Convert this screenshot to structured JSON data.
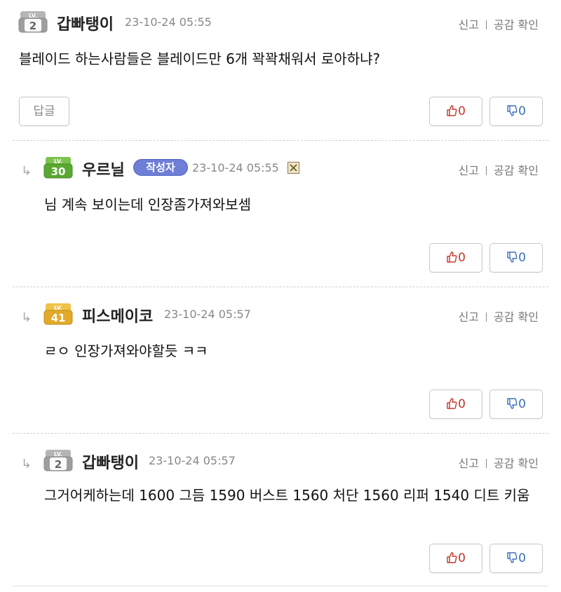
{
  "comments": [
    {
      "level": "2",
      "nickname": "갑빠탱이",
      "date": "23-10-24 05:55",
      "report": "신고",
      "likes_check": "공감 확인",
      "body": "블레이드 하는사람들은 블레이드만 6개 꽉꽉채워서 로아하냐?",
      "reply_label": "답글",
      "up_count": "0",
      "down_count": "0"
    },
    {
      "level": "30",
      "nickname": "우르닐",
      "author_badge": "작성자",
      "date": "23-10-24 05:55",
      "report": "신고",
      "likes_check": "공감 확인",
      "body": "님 계속 보이는데 인장좀가져와보셈",
      "up_count": "0",
      "down_count": "0"
    },
    {
      "level": "41",
      "nickname": "피스메이코",
      "date": "23-10-24 05:57",
      "report": "신고",
      "likes_check": "공감 확인",
      "body": "ㄹㅇ 인장가져와야할듯 ㅋㅋ",
      "up_count": "0",
      "down_count": "0"
    },
    {
      "level": "2",
      "nickname": "갑빠탱이",
      "date": "23-10-24 05:57",
      "report": "신고",
      "likes_check": "공감 확인",
      "body": "그거어케하는데 1600 그듬 1590 버스트 1560 처단 1560 리퍼 1540 디트 키움",
      "up_count": "0",
      "down_count": "0"
    }
  ],
  "colors": {
    "level_gray": "#9e9e9e",
    "level_green": "#5aa832",
    "level_gold": "#e2a92a",
    "author_badge": "#6f7ed6",
    "up": "#c0392b",
    "down": "#3d6fb8"
  }
}
